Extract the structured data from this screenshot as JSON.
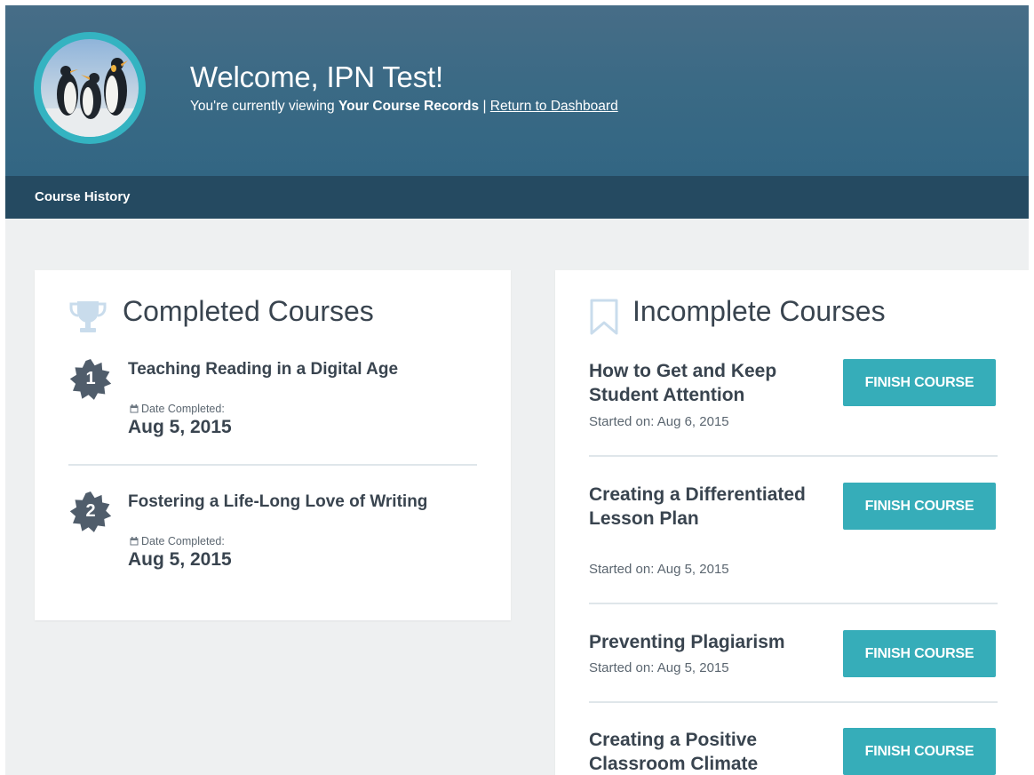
{
  "header": {
    "welcome": "Welcome, IPN Test!",
    "viewing_prefix": "You're currently viewing ",
    "viewing_bold": "Your Course Records",
    "separator": " | ",
    "dashboard_link": "Return to Dashboard"
  },
  "nav": {
    "course_history": "Course History"
  },
  "colors": {
    "accent": "#36adb9",
    "header": "#3b6a85",
    "navbar": "#254a61"
  },
  "completed": {
    "title": "Completed Courses",
    "icon": "trophy-icon",
    "items": [
      {
        "number": "1",
        "title": "Teaching Reading in a Digital Age",
        "date_label": "Date Completed:",
        "date": "Aug 5, 2015"
      },
      {
        "number": "2",
        "title": "Fostering a Life-Long Love of Writing",
        "date_label": "Date Completed:",
        "date": "Aug 5, 2015"
      }
    ]
  },
  "incomplete": {
    "title": "Incomplete Courses",
    "icon": "bookmark-icon",
    "button_label": "FINISH COURSE",
    "items": [
      {
        "title": "How to Get and Keep Student Attention",
        "started": "Started on: Aug 6, 2015"
      },
      {
        "title": "Creating a Differentiated Lesson Plan",
        "started": "Started on: Aug 5, 2015"
      },
      {
        "title": "Preventing Plagiarism",
        "started": "Started on: Aug 5, 2015"
      },
      {
        "title": "Creating a Positive Classroom Climate",
        "started": ""
      }
    ]
  }
}
